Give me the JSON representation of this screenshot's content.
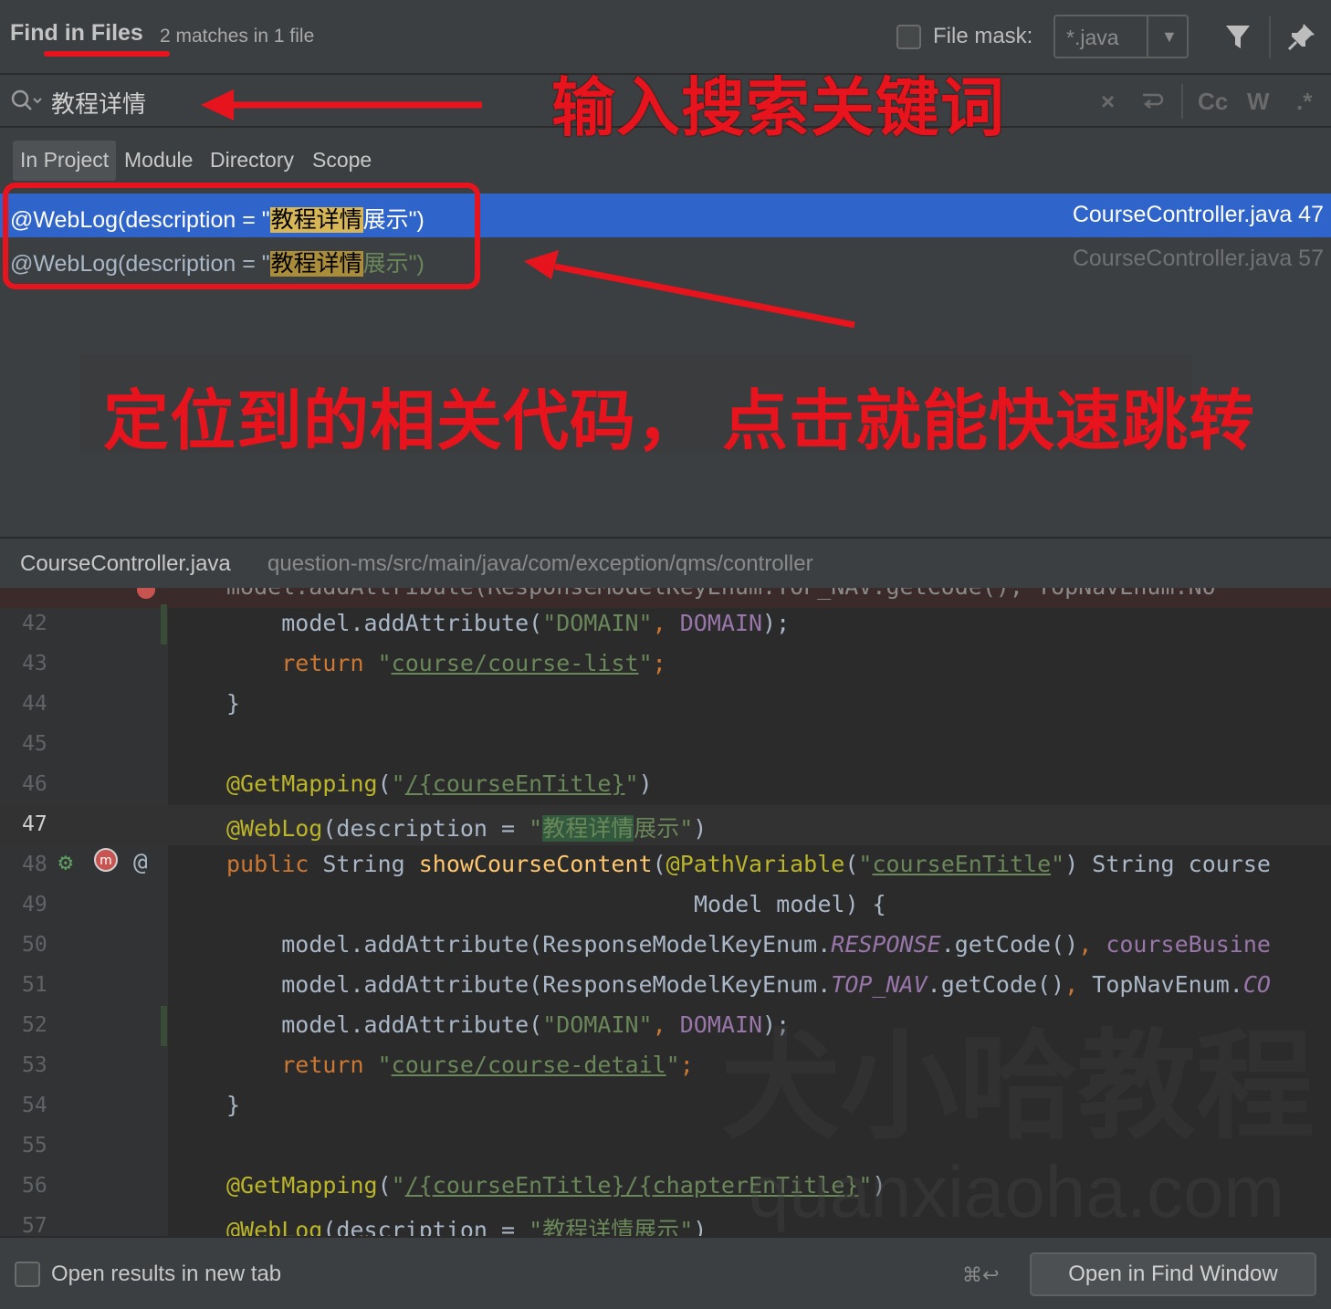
{
  "header": {
    "title": "Find in Files",
    "subtitle": "2 matches in 1 file",
    "file_mask_label": "File mask:",
    "file_mask_value": "*.java"
  },
  "search": {
    "query": "教程详情",
    "tools": {
      "case": "Cc",
      "words": "W",
      "regex": ".*"
    }
  },
  "scope_tabs": [
    {
      "label": "In Project",
      "active": true
    },
    {
      "label": "Module",
      "active": false
    },
    {
      "label": "Directory",
      "active": false
    },
    {
      "label": "Scope",
      "active": false
    }
  ],
  "results": [
    {
      "prefix": "@WebLog(description = \"",
      "match": "教程详情",
      "suffix": "展示\")",
      "file": "CourseController.java 47",
      "selected": true
    },
    {
      "prefix": "@WebLog(description = \"",
      "match": "教程详情",
      "suffix": "展示\")",
      "file": "CourseController.java 57",
      "selected": false
    }
  ],
  "annotations": {
    "search_hint": "输入搜索关键词",
    "result_hint": "定位到的相关代码， 点击就能快速跳转"
  },
  "path_bar": {
    "file": "CourseController.java",
    "dir": "question-ms/src/main/java/com/exception/qms/controller"
  },
  "editor": {
    "line_numbers": [
      "42",
      "43",
      "44",
      "45",
      "46",
      "47",
      "48",
      "49",
      "50",
      "51",
      "52",
      "53",
      "54",
      "55",
      "56",
      "57"
    ],
    "current_line": "47",
    "tokens": {
      "t_model_add": "model.addAttribute(",
      "t_domain_str": "\"DOMAIN\"",
      "t_comma": ", ",
      "t_domain": "DOMAIN",
      "t_close": ");",
      "t_return": "return ",
      "t_q": "\"",
      "t_course_list": "course/course-list",
      "t_semicolon": ";",
      "t_brace": "}",
      "t_getmapping": "@GetMapping",
      "t_paren": "(",
      "t_path1": "/{courseEnTitle}",
      "t_paren_close": ")",
      "t_weblog": "@WebLog",
      "t_desc": "(description = ",
      "t_match": "教程详情",
      "t_rest": "展示",
      "t_public": "public ",
      "t_string": "String ",
      "t_method": "showCourseContent",
      "t_pathvar": "@PathVariable",
      "t_course_en_title": "courseEnTitle",
      "t_string_course": ") String course",
      "t_model_model": "Model model) {",
      "t_rm_key": "ResponseModelKeyEnum.",
      "t_response": "RESPONSE",
      "t_getcode": ".getCode()",
      "t_course_busi": "courseBusine",
      "t_top_nav": "TOP_NAV",
      "t_topnavenum": "TopNavEnum.",
      "t_co": "CO",
      "t_course_detail": "course/course-detail",
      "t_path2": "/{courseEnTitle}/{chapterEnTitle}",
      "t_line57_str": "\"教程详情展示\"",
      "t_partial_top": "model.addAttribute(ResponseModelKeyEnum.TOP_NAV.getCode(), TopNavEnum.NO"
    }
  },
  "watermark": {
    "text": "犬小哈教程",
    "url": "quanxiaoha.com"
  },
  "footer": {
    "checkbox_label": "Open results in new tab",
    "shortcut": "⌘↩",
    "open_button": "Open in Find Window"
  },
  "colors": {
    "selection": "#2f65ca",
    "annotation_red": "#e8141d",
    "match_highlight": "#d6b656"
  }
}
